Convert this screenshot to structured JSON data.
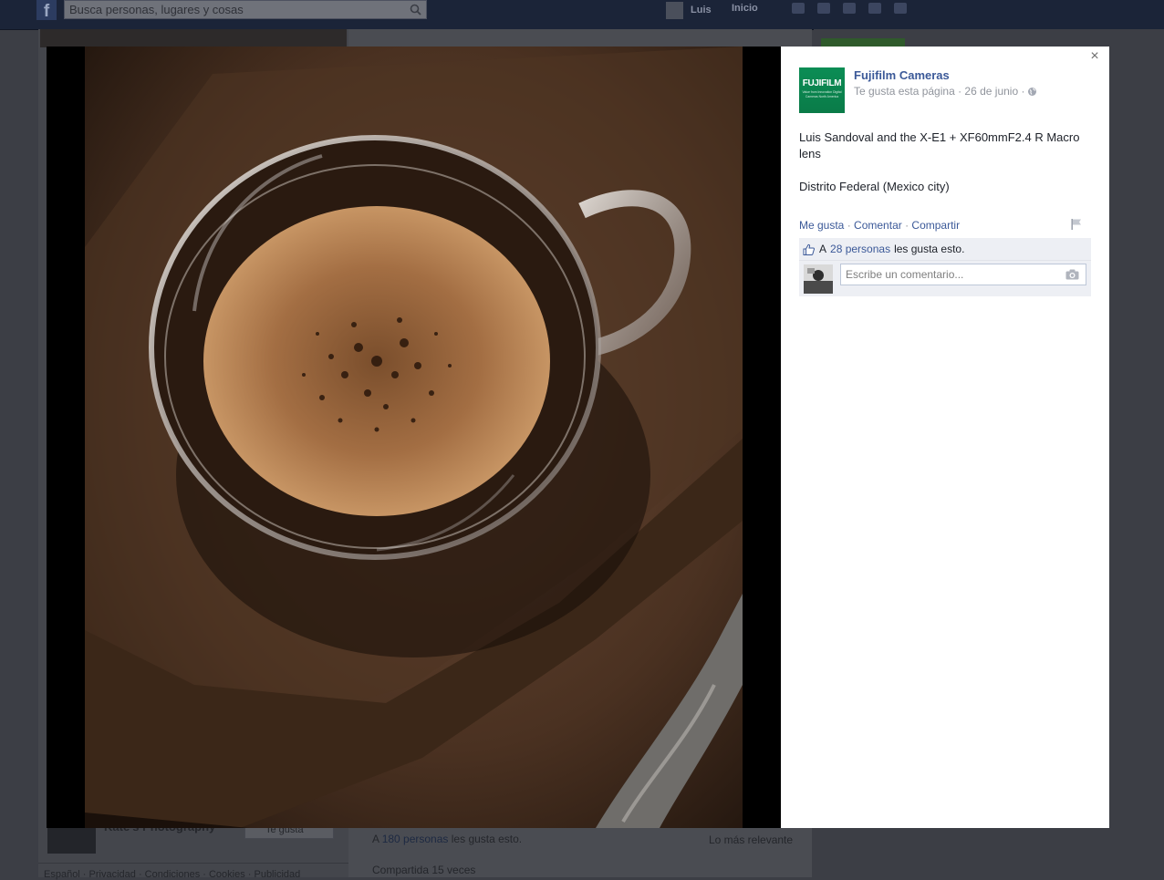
{
  "topbar": {
    "search_placeholder": "Busca personas, lugares y cosas",
    "user_name": "Luis",
    "home_label": "Inicio",
    "logo_icon": "facebook-f-icon"
  },
  "background_page": {
    "page_name": "Kate's Photography",
    "like_button_label": "Te gusta",
    "likes_prefix": "A",
    "likes_link": "180 personas",
    "likes_suffix": "les gusta esto.",
    "sort_label": "Lo más relevante",
    "shared_label": "Compartida 15 veces",
    "footer_links": "Español · Privacidad · Condiciones · Cookies · Publicidad"
  },
  "post": {
    "page_name": "Fujifilm Cameras",
    "logo_text": "FUJIFILM",
    "logo_subtext": "Value from Innovation Digital Cameras North America",
    "page_status": "Te gusta esta página",
    "date": "26 de junio",
    "caption_line1": "Luis Sandoval and the X-E1 + XF60mmF2.4 R Macro lens",
    "caption_line2": "Distrito Federal (Mexico city)",
    "actions": {
      "like": "Me gusta",
      "comment": "Comentar",
      "share": "Compartir"
    },
    "likes": {
      "prefix": "A",
      "link": "28 personas",
      "suffix": "les gusta esto."
    },
    "comment_placeholder": "Escribe un comentario...",
    "close_glyph": "×"
  },
  "colors": {
    "link_blue": "#3b5998",
    "panel_gray": "#edeff4",
    "fujifilm_green": "#0b8d55"
  }
}
